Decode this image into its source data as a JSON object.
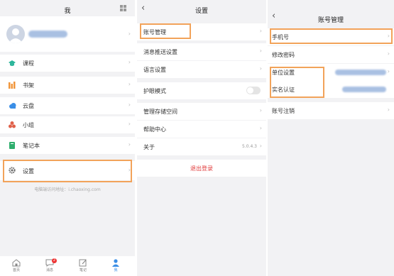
{
  "me": {
    "title": "我",
    "menu": [
      {
        "label": "课程",
        "icon": "graduation-cap-icon",
        "color": "#2bb59a"
      },
      {
        "label": "书架",
        "icon": "bookshelf-icon",
        "color": "#f0953a"
      },
      {
        "label": "云盘",
        "icon": "cloud-icon",
        "color": "#3a8ee6"
      },
      {
        "label": "小组",
        "icon": "group-icon",
        "color": "#e0614a"
      },
      {
        "label": "笔记本",
        "icon": "notebook-icon",
        "color": "#2fae6d"
      }
    ],
    "settings_label": "设置",
    "pc_address": "电脑端访问地址：i.chaoxing.com",
    "tabs": [
      {
        "label": "首页",
        "icon": "home-icon"
      },
      {
        "label": "消息",
        "icon": "message-icon",
        "badge": "2"
      },
      {
        "label": "笔记",
        "icon": "note-edit-icon"
      },
      {
        "label": "我",
        "icon": "user-icon",
        "active": true
      }
    ],
    "accent": "#3a8ee6",
    "highlight": "#f2a35a"
  },
  "settings": {
    "title": "设置",
    "items": {
      "account": "账号管理",
      "push": "消息推送设置",
      "language": "语言设置",
      "eye_mode": "护眼模式",
      "storage": "管理存储空间",
      "help": "帮助中心",
      "about": "关于",
      "version": "5.0.4.3"
    },
    "logout": "退出登录",
    "logout_color": "#e03c3c"
  },
  "account": {
    "title": "账号管理",
    "items": {
      "phone": "手机号",
      "password": "修改密码",
      "unit": "单位设置",
      "realname": "实名认证",
      "cancel": "账号注销"
    }
  }
}
